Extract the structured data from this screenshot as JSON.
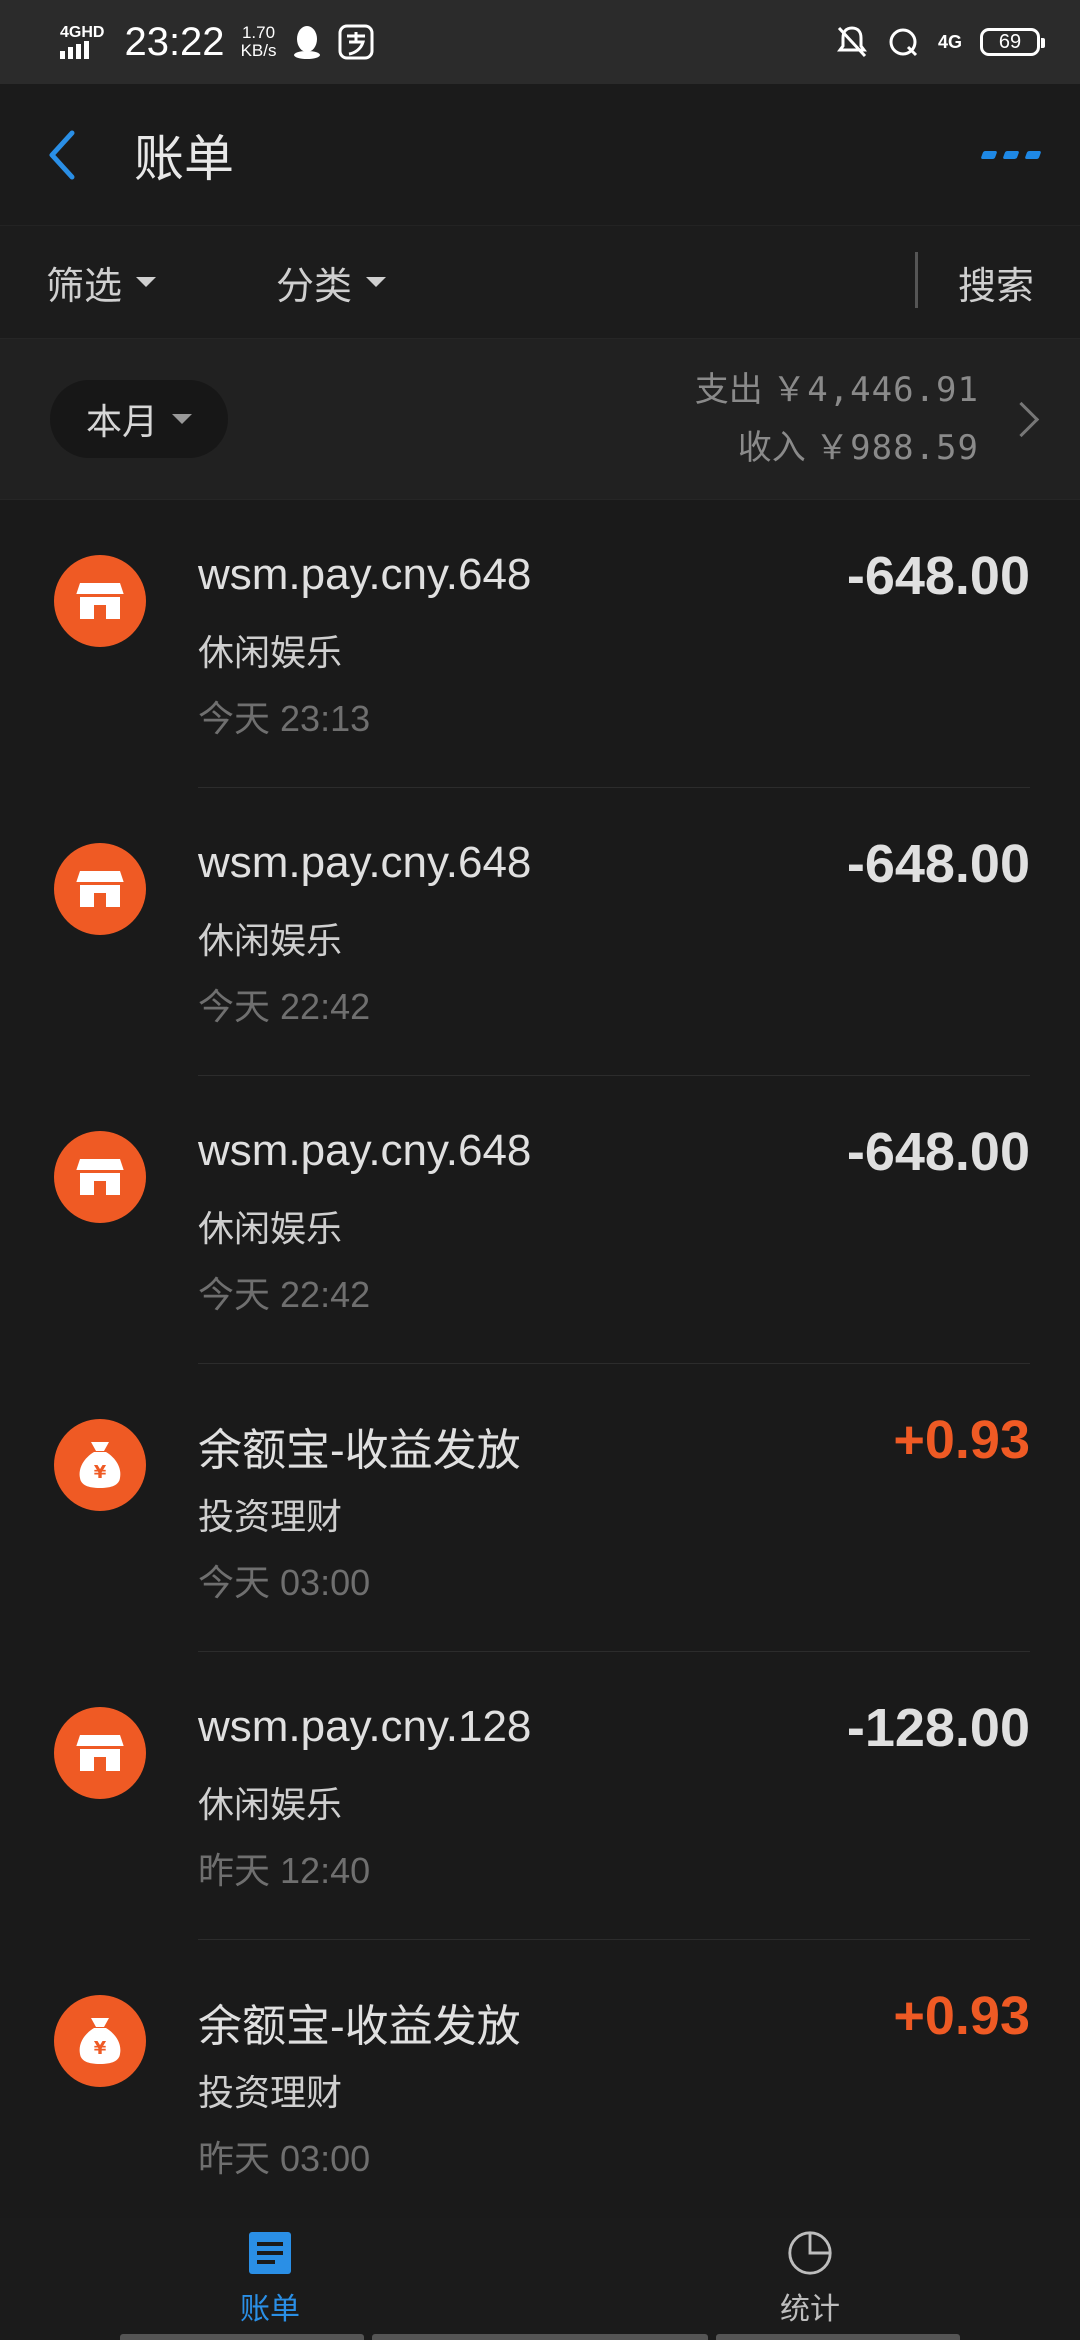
{
  "status_bar": {
    "network": "4GHD",
    "time": "23:22",
    "speed_value": "1.70",
    "speed_unit": "KB/s",
    "signal_right": "4G",
    "battery": "69"
  },
  "header": {
    "title": "账单"
  },
  "filters": {
    "filter_label": "筛选",
    "category_label": "分类",
    "search_label": "搜索"
  },
  "summary": {
    "period": "本月",
    "expense_label": "支出",
    "expense_amount": "￥4,446.91",
    "income_label": "收入",
    "income_amount": "￥988.59"
  },
  "transactions": [
    {
      "icon": "shop-icon",
      "merchant": "wsm.pay.cny.648",
      "category": "休闲娱乐",
      "day": "今天",
      "time": "23:13",
      "amount": "-648.00",
      "direction": "out"
    },
    {
      "icon": "shop-icon",
      "merchant": "wsm.pay.cny.648",
      "category": "休闲娱乐",
      "day": "今天",
      "time": "22:42",
      "amount": "-648.00",
      "direction": "out"
    },
    {
      "icon": "shop-icon",
      "merchant": "wsm.pay.cny.648",
      "category": "休闲娱乐",
      "day": "今天",
      "time": "22:42",
      "amount": "-648.00",
      "direction": "out"
    },
    {
      "icon": "money-bag-icon",
      "merchant": "余额宝-收益发放",
      "category": "投资理财",
      "day": "今天",
      "time": "03:00",
      "amount": "+0.93",
      "direction": "in"
    },
    {
      "icon": "shop-icon",
      "merchant": "wsm.pay.cny.128",
      "category": "休闲娱乐",
      "day": "昨天",
      "time": "12:40",
      "amount": "-128.00",
      "direction": "out"
    },
    {
      "icon": "money-bag-icon",
      "merchant": "余额宝-收益发放",
      "category": "投资理财",
      "day": "昨天",
      "time": "03:00",
      "amount": "+0.93",
      "direction": "in"
    }
  ],
  "tabs": [
    {
      "label": "账单",
      "icon": "bill-icon",
      "active": true
    },
    {
      "label": "统计",
      "icon": "pie-chart-icon",
      "active": false
    }
  ],
  "colors": {
    "accent_blue": "#2a8fe6",
    "accent_orange": "#ef5a24",
    "background": "#1a1a1a"
  }
}
